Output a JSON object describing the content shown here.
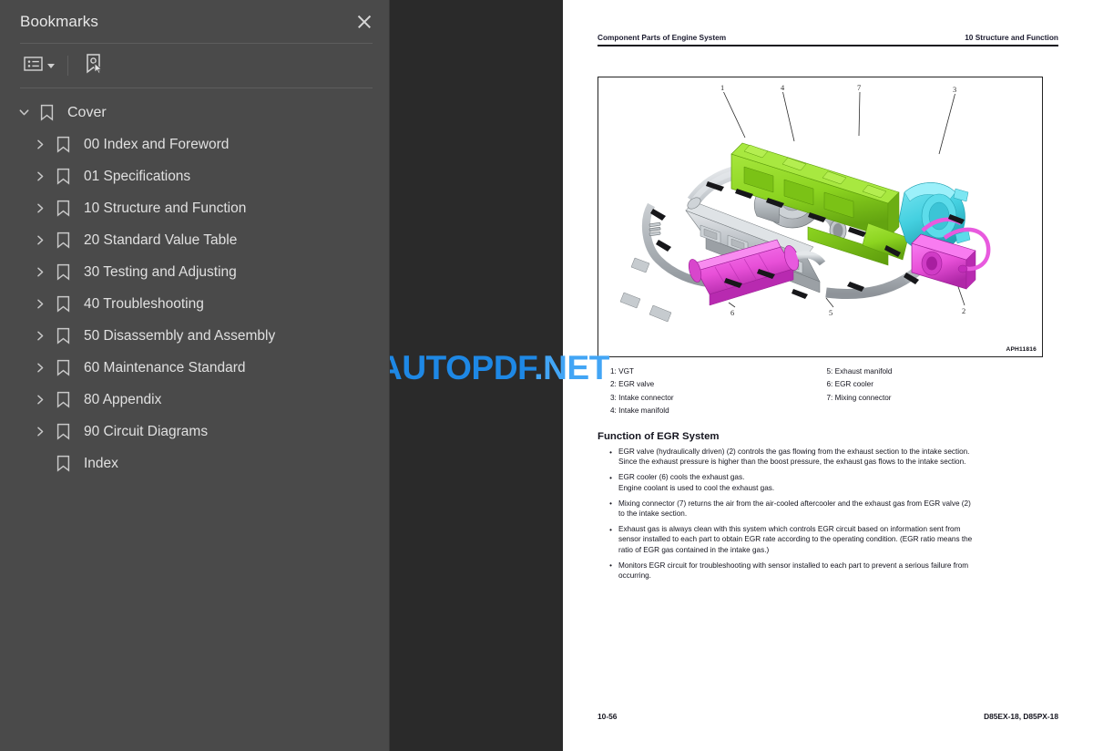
{
  "sidebar": {
    "title": "Bookmarks",
    "close_icon": "close-icon",
    "toolbar": {
      "options_icon": "list-options-icon",
      "caret_icon": "chevron-down-icon",
      "new_bookmark_icon": "new-bookmark-icon"
    },
    "tree": [
      {
        "label": "Cover",
        "level": 0,
        "expanded": true,
        "has_children": true
      },
      {
        "label": "00 Index and Foreword",
        "level": 1,
        "expanded": false,
        "has_children": true
      },
      {
        "label": "01 Specifications",
        "level": 1,
        "expanded": false,
        "has_children": true
      },
      {
        "label": "10 Structure and Function",
        "level": 1,
        "expanded": false,
        "has_children": true
      },
      {
        "label": "20 Standard Value Table",
        "level": 1,
        "expanded": false,
        "has_children": true
      },
      {
        "label": "30 Testing and Adjusting",
        "level": 1,
        "expanded": false,
        "has_children": true
      },
      {
        "label": "40 Troubleshooting",
        "level": 1,
        "expanded": false,
        "has_children": true
      },
      {
        "label": "50 Disassembly and Assembly",
        "level": 1,
        "expanded": false,
        "has_children": true
      },
      {
        "label": "60 Maintenance Standard",
        "level": 1,
        "expanded": false,
        "has_children": true
      },
      {
        "label": "80 Appendix",
        "level": 1,
        "expanded": false,
        "has_children": true
      },
      {
        "label": "90 Circuit Diagrams",
        "level": 1,
        "expanded": false,
        "has_children": true
      },
      {
        "label": "Index",
        "level": 1,
        "expanded": false,
        "has_children": false
      }
    ]
  },
  "watermark": {
    "text_dark": "AUTOPDF",
    "text_dot": ".",
    "text_light": "NET",
    "color_dark": "#1e88e5",
    "color_light": "#42a5f5"
  },
  "document": {
    "header_left": "Component Parts of Engine System",
    "header_right": "10 Structure and Function",
    "figure_id": "APH11816",
    "figure_callouts": [
      "1",
      "4",
      "7",
      "3",
      "6",
      "5",
      "2"
    ],
    "legend_left": [
      "1: VGT",
      "2: EGR valve",
      "3: Intake connector",
      "4: Intake manifold"
    ],
    "legend_right": [
      "5: Exhaust manifold",
      "6: EGR cooler",
      "7: Mixing connector"
    ],
    "section_title": "Function of EGR System",
    "bullets": [
      [
        "EGR valve (hydraulically driven) (2) controls the gas flowing from the exhaust section to the intake section.",
        "Since the exhaust pressure is higher than the boost pressure, the exhaust gas flows to the intake section."
      ],
      [
        "EGR cooler (6) cools the exhaust gas.",
        "Engine coolant is used to cool the exhaust gas."
      ],
      [
        "Mixing connector (7) returns the air from the air-cooled aftercooler and the exhaust gas from EGR valve (2)",
        "to the intake section."
      ],
      [
        "Exhaust gas is always clean with this system which controls EGR circuit based on information sent from",
        "sensor installed to each part to obtain EGR rate according to the operating condition. (EGR ratio means the",
        "ratio of EGR gas contained in the intake gas.)"
      ],
      [
        "Monitors EGR circuit for troubleshooting with sensor installed to each part to prevent a serious failure from",
        "occurring."
      ]
    ],
    "footer_left": "10-56",
    "footer_right": "D85EX-18, D85PX-18"
  },
  "colors": {
    "sidebar_bg": "#4a4a4a",
    "viewer_bg": "#2a2a2a",
    "page_bg": "#ffffff",
    "part_green": "#8cd420",
    "part_cyan": "#44d0e0",
    "part_magenta": "#e850d8",
    "part_violet": "#c83cd2",
    "part_gray": "#b8bcc0"
  }
}
